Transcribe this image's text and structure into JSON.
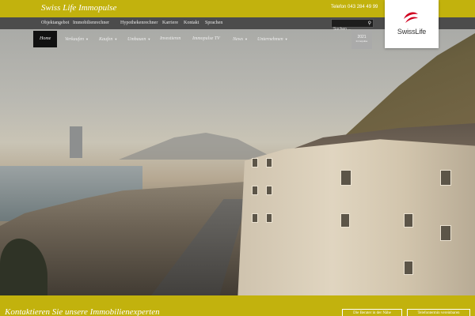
{
  "header": {
    "brand": "Swiss Life Immopulse",
    "phone": "Telefon 043 284 49 99"
  },
  "subnav": {
    "items": [
      {
        "label": "Objektangebot",
        "name": "subnav-objektangebot"
      },
      {
        "label": "Immobilienrechner",
        "name": "subnav-immobilienrechner"
      },
      {
        "label": "Hypothekenrechner",
        "name": "subnav-hypothekenrechner"
      },
      {
        "label": "Karriere",
        "name": "subnav-karriere"
      },
      {
        "label": "Kontakt",
        "name": "subnav-kontakt"
      },
      {
        "label": "Sprachen",
        "name": "subnav-sprachen"
      }
    ]
  },
  "search": {
    "placeholder": "Suchen ..."
  },
  "logo": {
    "text": "SwissLife",
    "color": "#d0001f"
  },
  "menu": {
    "items": [
      {
        "label": "Home",
        "active": true,
        "dropdown": false
      },
      {
        "label": "Verkaufen",
        "active": false,
        "dropdown": true
      },
      {
        "label": "Kaufen",
        "active": false,
        "dropdown": true
      },
      {
        "label": "Umbauen",
        "active": false,
        "dropdown": true
      },
      {
        "label": "Investieren",
        "active": false,
        "dropdown": false
      },
      {
        "label": "Immopulse TV",
        "active": false,
        "dropdown": false
      },
      {
        "label": "News",
        "active": false,
        "dropdown": true
      },
      {
        "label": "Unternehmen",
        "active": false,
        "dropdown": true
      }
    ]
  },
  "badge": {
    "year": "2021",
    "sub": "Immopulse"
  },
  "footer": {
    "title": "Kontaktieren Sie unsere Immobilienexperten",
    "buttons": [
      {
        "label": "Die Berater in der Nähe"
      },
      {
        "label": "Telefontermin vereinbaren"
      }
    ]
  },
  "colors": {
    "accent": "#c2b20d",
    "menu_active": "#111111"
  }
}
